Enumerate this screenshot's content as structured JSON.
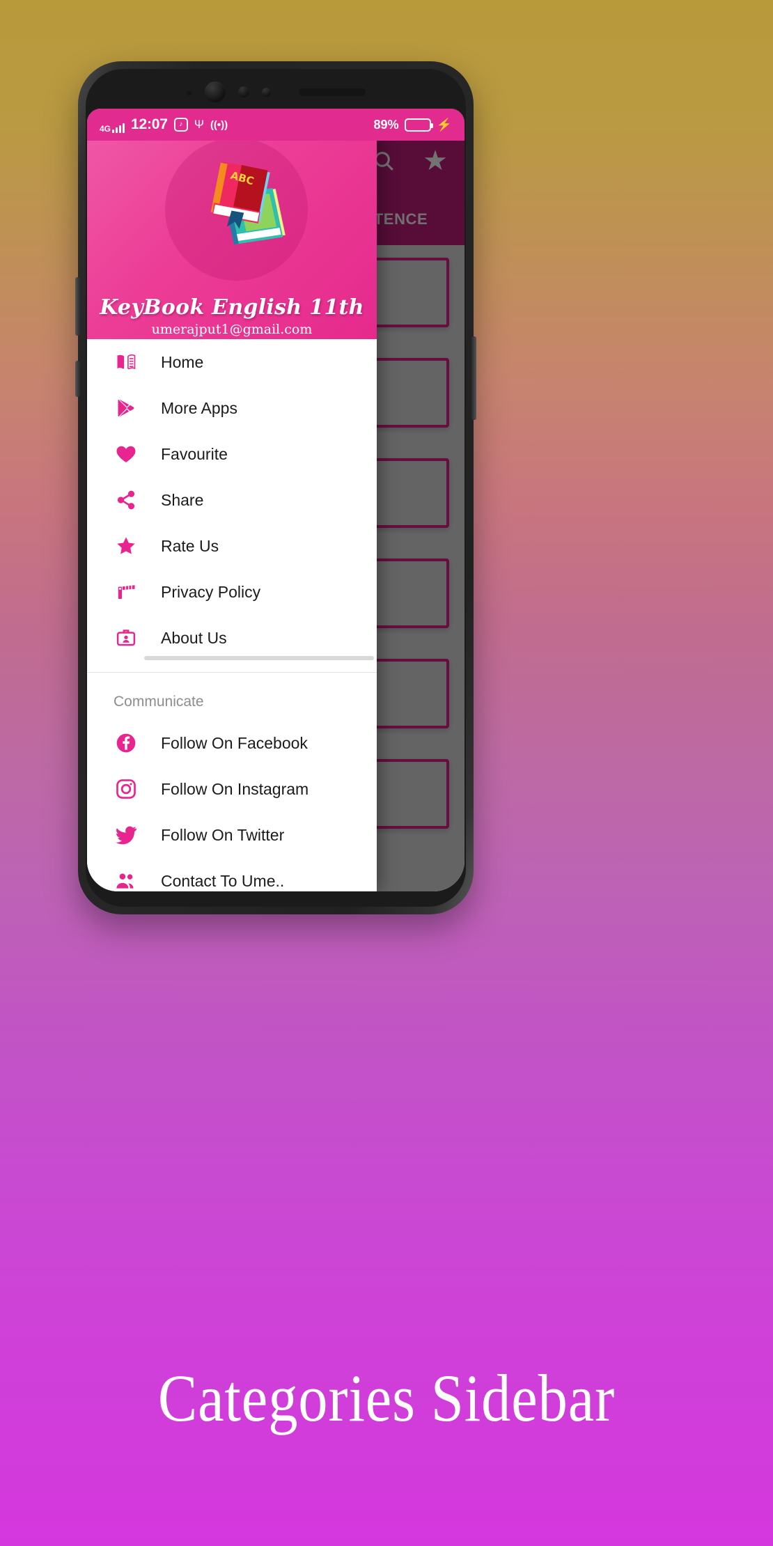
{
  "statusbar": {
    "network_type": "4G",
    "time": "12:07",
    "vibrate_icon": "vibrate-mode-icon",
    "usb_icon": "usb-icon",
    "cast_icon": "cast-icon",
    "battery_percent": "89%",
    "battery_level": 89,
    "charging_icon": "charging-bolt-icon"
  },
  "background_app": {
    "appbar_color": "#6b1145",
    "search_icon": "search-icon",
    "favourite_icon": "star-icon",
    "tab_label": "ENTENCE",
    "card_count": 6,
    "card_border_color": "#7d1250"
  },
  "drawer": {
    "header": {
      "logo": "books-abc-icon",
      "title": "KeyBook English 11th",
      "email": "umerajput1@gmail.com",
      "bg_color_start": "#f05ba8",
      "bg_color_end": "#e52a8c"
    },
    "accent_color": "#e8258e",
    "items": [
      {
        "label": "Home",
        "icon": "open-book-icon"
      },
      {
        "label": "More Apps",
        "icon": "google-play-icon"
      },
      {
        "label": "Favourite",
        "icon": "heart-icon"
      },
      {
        "label": "Share",
        "icon": "share-icon"
      },
      {
        "label": "Rate Us",
        "icon": "star-icon"
      },
      {
        "label": "Privacy Policy",
        "icon": "barrier-gate-icon"
      },
      {
        "label": "About Us",
        "icon": "id-badge-icon"
      }
    ],
    "section_label": "Communicate",
    "social_items": [
      {
        "label": "Follow On Facebook",
        "icon": "facebook-icon"
      },
      {
        "label": "Follow On Instagram",
        "icon": "instagram-icon"
      },
      {
        "label": "Follow On Twitter",
        "icon": "twitter-icon"
      },
      {
        "label": "Contact To Ume..",
        "icon": "people-group-icon"
      }
    ]
  },
  "caption": "Categories Sidebar",
  "page_background": {
    "gradient_start": "#b89a3b",
    "gradient_end": "#d437de"
  }
}
